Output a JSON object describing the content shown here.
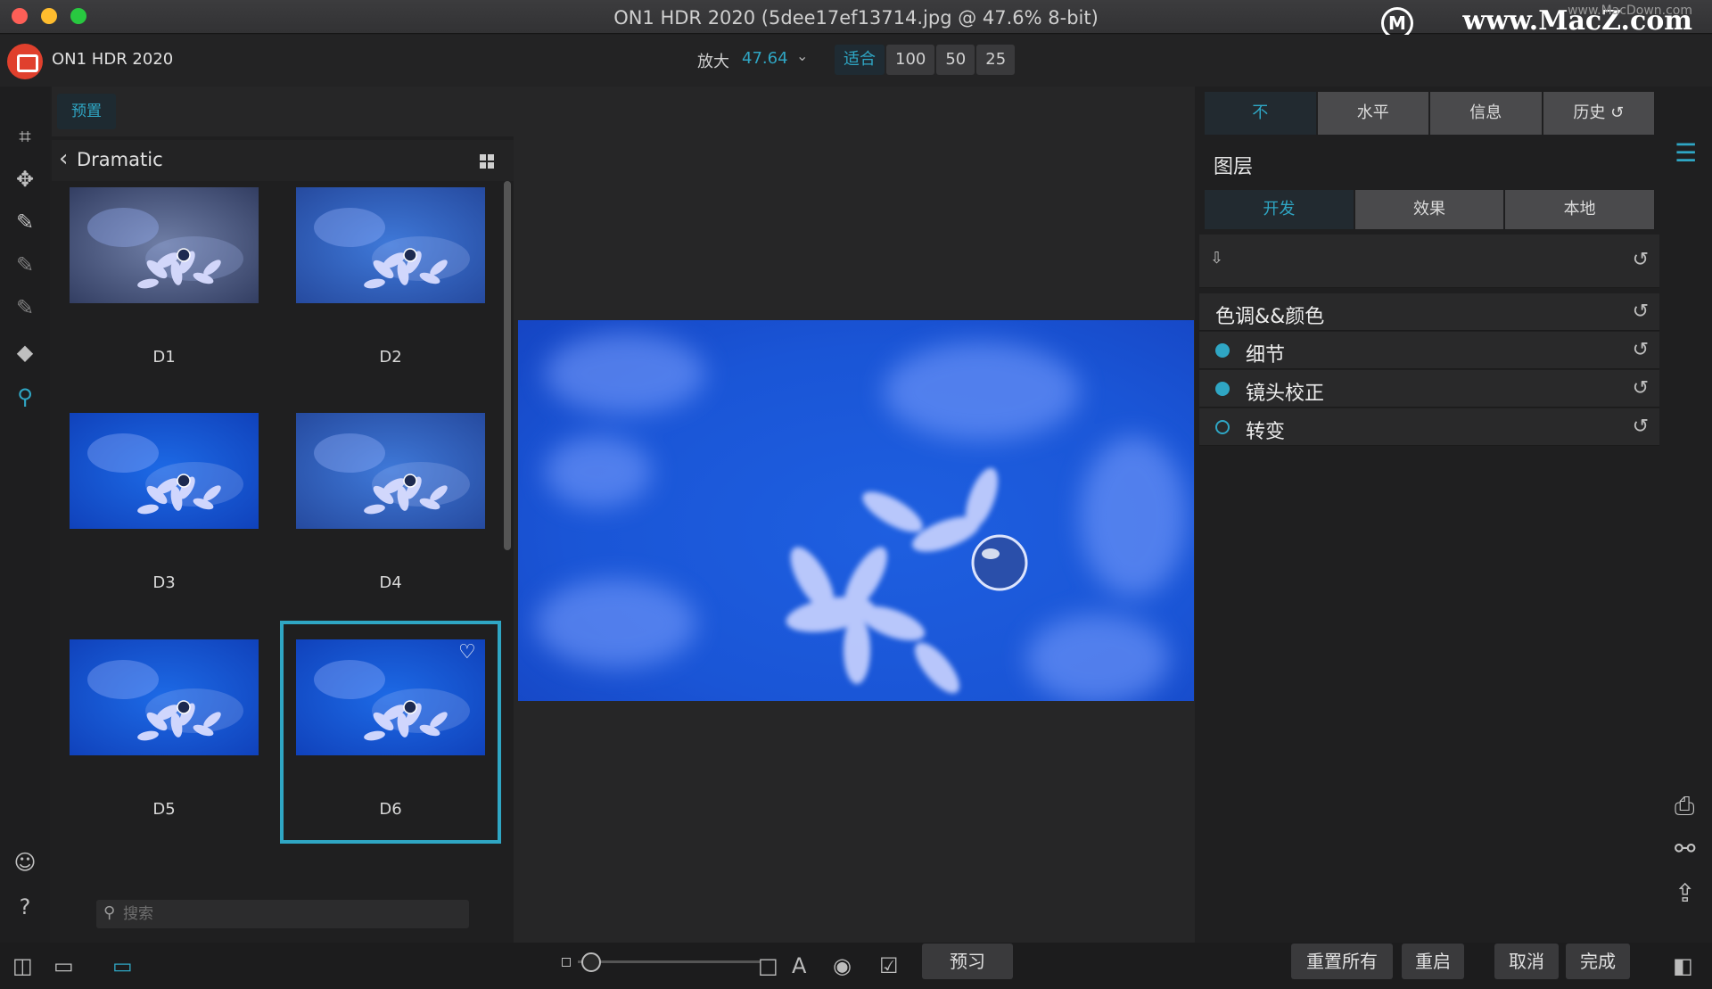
{
  "window": {
    "title": "ON1 HDR 2020 (5dee17ef13714.jpg @ 47.6% 8-bit)"
  },
  "watermark": {
    "text": "www.MacZ.com",
    "sub": "www.MacDown.com"
  },
  "toolbar": {
    "app_name": "ON1 HDR 2020",
    "zoom_label": "放大",
    "zoom_value": "47.64",
    "zoom_buttons": [
      "适合",
      "100",
      "50",
      "25"
    ]
  },
  "tools": [
    "crop-icon",
    "move-icon",
    "brush-icon",
    "masking-brush-icon",
    "refine-brush-icon",
    "eraser-icon",
    "zoom-hand-icon"
  ],
  "preset_panel": {
    "tab": "预置",
    "category": "Dramatic",
    "presets": [
      "D1",
      "D2",
      "D3",
      "D4",
      "D5",
      "D6"
    ],
    "selected": "D6",
    "search_placeholder": "搜索"
  },
  "right_panel": {
    "tabs": [
      "不",
      "水平",
      "信息",
      "历史 ↺"
    ],
    "layers_title": "图层",
    "sub_tabs": [
      "开发",
      "效果",
      "本地"
    ],
    "sections": [
      {
        "label": "色调&&颜色",
        "dot": "none"
      },
      {
        "label": "细节",
        "dot": "on"
      },
      {
        "label": "镜头校正",
        "dot": "on"
      },
      {
        "label": "转变",
        "dot": "off"
      }
    ]
  },
  "bottom": {
    "preview_label": "预习",
    "reset_all": "重置所有",
    "restart": "重启",
    "cancel": "取消",
    "done": "完成"
  },
  "colors": {
    "accent": "#2fa6c4",
    "panel": "#29292a",
    "background": "#1f1f20"
  }
}
